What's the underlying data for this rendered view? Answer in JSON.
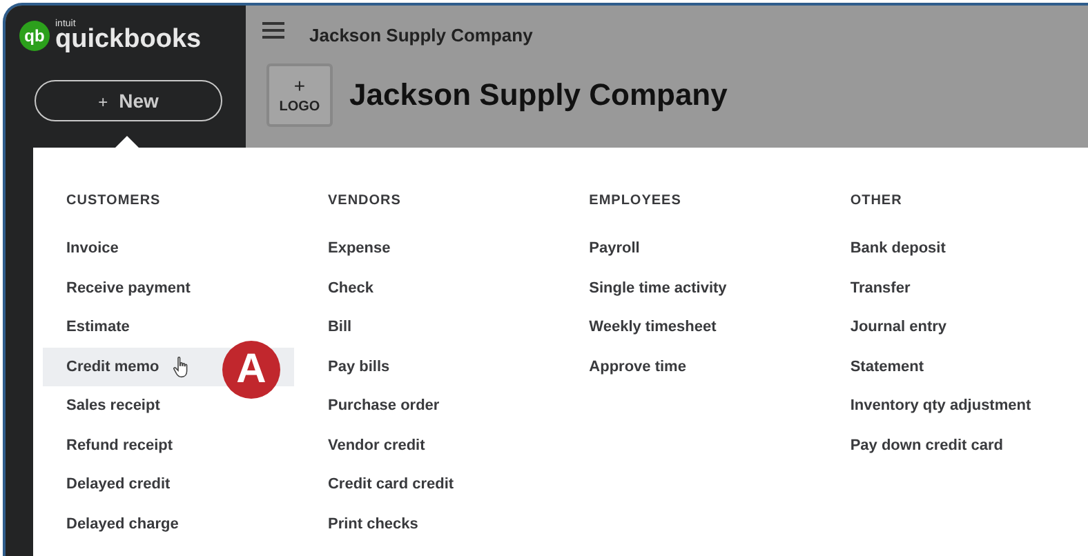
{
  "sidebar": {
    "logo": {
      "mark": "qb",
      "brand_small": "intuit",
      "brand": "quickbooks"
    },
    "new_button": {
      "icon_text": "+",
      "label": "New"
    }
  },
  "header": {
    "company": "Jackson Supply Company"
  },
  "company_banner": {
    "logo_button": {
      "plus": "+",
      "label": "LOGO"
    },
    "name": "Jackson Supply Company"
  },
  "new_menu": {
    "columns": [
      {
        "heading": "CUSTOMERS",
        "items": [
          {
            "label": "Invoice",
            "selected": false
          },
          {
            "label": "Receive payment",
            "selected": false
          },
          {
            "label": "Estimate",
            "selected": false
          },
          {
            "label": "Credit memo",
            "selected": true
          },
          {
            "label": "Sales receipt",
            "selected": false
          },
          {
            "label": "Refund receipt",
            "selected": false
          },
          {
            "label": "Delayed credit",
            "selected": false
          },
          {
            "label": "Delayed charge",
            "selected": false
          }
        ]
      },
      {
        "heading": "VENDORS",
        "items": [
          {
            "label": "Expense",
            "selected": false
          },
          {
            "label": "Check",
            "selected": false
          },
          {
            "label": "Bill",
            "selected": false
          },
          {
            "label": "Pay bills",
            "selected": false
          },
          {
            "label": "Purchase order",
            "selected": false
          },
          {
            "label": "Vendor credit",
            "selected": false
          },
          {
            "label": "Credit card credit",
            "selected": false
          },
          {
            "label": "Print checks",
            "selected": false
          }
        ]
      },
      {
        "heading": "EMPLOYEES",
        "items": [
          {
            "label": "Payroll",
            "selected": false
          },
          {
            "label": "Single time activity",
            "selected": false
          },
          {
            "label": "Weekly timesheet",
            "selected": false
          },
          {
            "label": "Approve time",
            "selected": false
          }
        ]
      },
      {
        "heading": "OTHER",
        "items": [
          {
            "label": "Bank deposit",
            "selected": false
          },
          {
            "label": "Transfer",
            "selected": false
          },
          {
            "label": "Journal entry",
            "selected": false
          },
          {
            "label": "Statement",
            "selected": false
          },
          {
            "label": "Inventory qty adjustment",
            "selected": false
          },
          {
            "label": "Pay down credit card",
            "selected": false
          }
        ]
      }
    ]
  },
  "annotation": {
    "label": "A"
  }
}
